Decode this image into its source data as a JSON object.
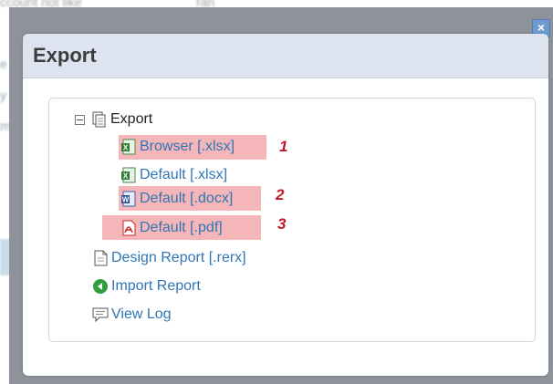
{
  "background": {
    "text_fragments": [
      "ccount not like",
      "ran",
      "e",
      "y",
      "m",
      "p"
    ]
  },
  "dialog": {
    "title": "Export",
    "close_glyph": "×",
    "tree": {
      "root": {
        "label": "Export",
        "toggle": "collapse",
        "icon": "documents-icon"
      },
      "items": [
        {
          "label": "Browser [.xlsx]",
          "icon": "excel-icon",
          "highlighted": true,
          "marker": "1"
        },
        {
          "label": "Default [.xlsx]",
          "icon": "excel-icon",
          "highlighted": false,
          "marker": ""
        },
        {
          "label": "Default [.docx]",
          "icon": "word-icon",
          "highlighted": true,
          "marker": "2"
        },
        {
          "label": "Default [.pdf]",
          "icon": "pdf-icon",
          "highlighted": true,
          "marker": "3"
        }
      ],
      "actions": [
        {
          "label": "Design Report [.rerx]",
          "icon": "document-icon"
        },
        {
          "label": "Import Report",
          "icon": "green-circle-arrow-icon"
        },
        {
          "label": "View Log",
          "icon": "speech-bubble-icon"
        }
      ]
    }
  },
  "colors": {
    "link": "#2f76b4",
    "highlight": "#f4b6b8",
    "marker": "#c0172a",
    "header_bg": "#dde4ef",
    "overlay": "#8d9398"
  }
}
